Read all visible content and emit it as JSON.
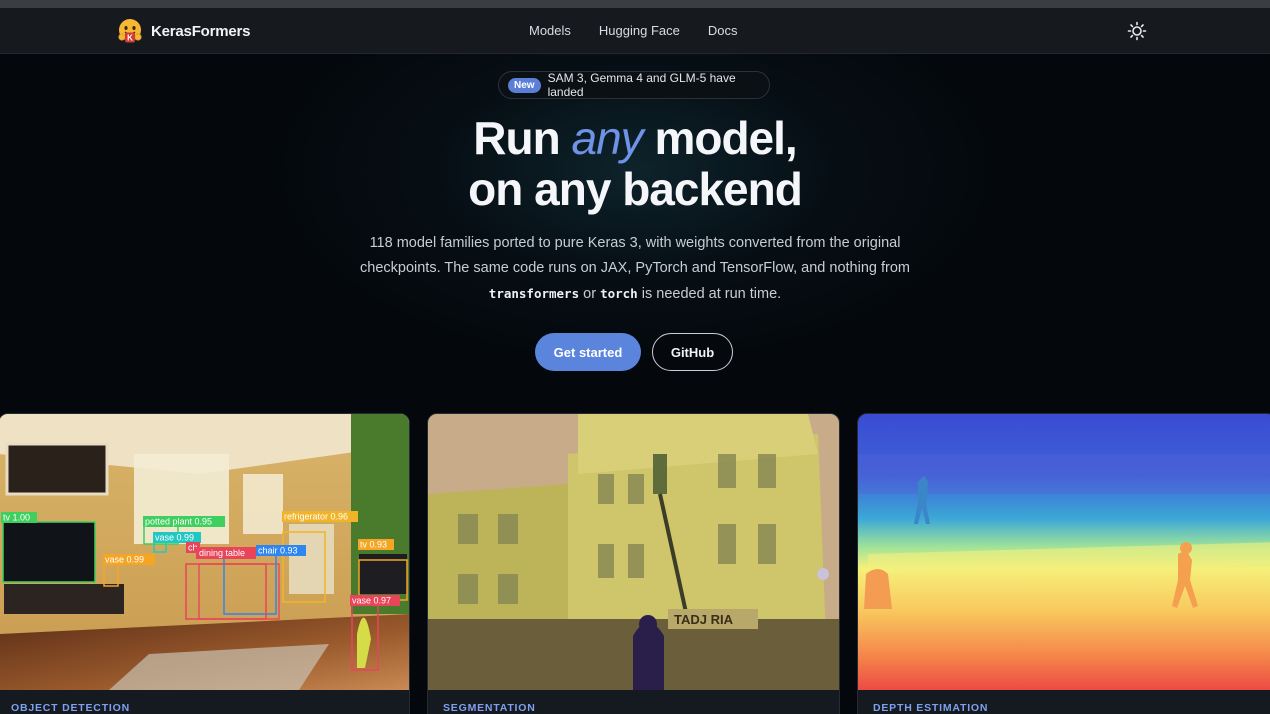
{
  "brand": {
    "name": "KerasFormers",
    "logo_letter": "K"
  },
  "nav": {
    "links": [
      "Models",
      "Hugging Face",
      "Docs"
    ]
  },
  "theme_toggle": {
    "icon": "sun-icon"
  },
  "announcement": {
    "tag": "New",
    "text": "SAM 3, Gemma 4 and GLM-5 have landed"
  },
  "hero": {
    "line1_a": "Run",
    "line1_accent": "any",
    "line1_b": "model,",
    "line2": "on any backend",
    "sub_line1": "118 model families ported to pure Keras 3, with weights converted from the original",
    "sub_line2": "checkpoints. The same code runs on JAX, PyTorch and TensorFlow, and nothing from",
    "code1": "transformers",
    "or_word": "or",
    "code2": "torch",
    "sub_tail": "is needed at run time."
  },
  "actions": {
    "primary": "Get started",
    "secondary": "GitHub"
  },
  "cards": [
    {
      "label": "OBJECT DETECTION",
      "detections": [
        {
          "label": "tv 1.00",
          "color": "#3ecf5e"
        },
        {
          "label": "potted plant 0.95",
          "color": "#3ecf5e"
        },
        {
          "label": "vase 0.99",
          "color": "#22c7c2"
        },
        {
          "label": "refrigerator 0.96",
          "color": "#f1b428"
        },
        {
          "label": "vase 0.99",
          "color": "#f5a524"
        },
        {
          "label": "ch",
          "color": "#e8455a"
        },
        {
          "label": "dining table",
          "color": "#e8455a"
        },
        {
          "label": "chair 0.93",
          "color": "#2f86f0"
        },
        {
          "label": "tv 0.93",
          "color": "#f5a524"
        },
        {
          "label": "vase 0.97",
          "color": "#e8455a"
        }
      ]
    },
    {
      "label": "SEGMENTATION",
      "sign": "TADJ RIA"
    },
    {
      "label": "DEPTH ESTIMATION"
    }
  ],
  "colors": {
    "accent": "#5b85dc",
    "accent_text": "#6f93e6",
    "background": "#04070b"
  }
}
